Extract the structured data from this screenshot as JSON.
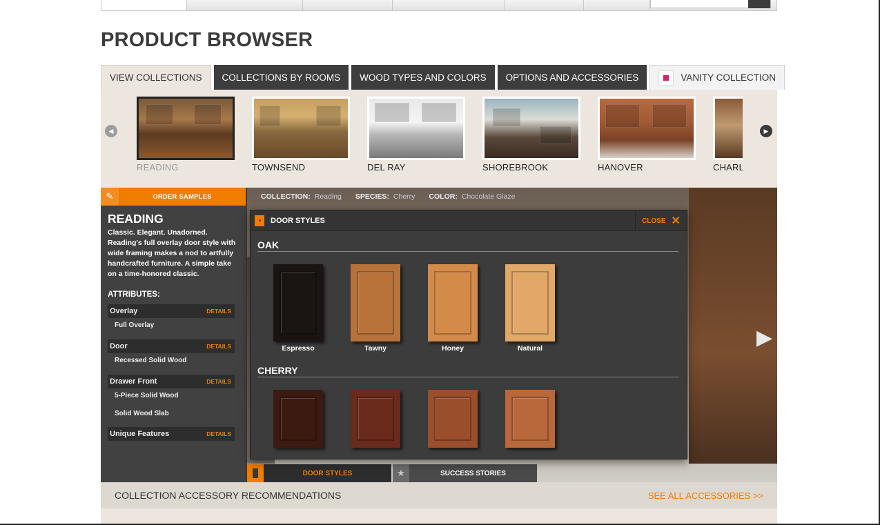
{
  "page_title": "PRODUCT BROWSER",
  "tabs": [
    {
      "label": "VIEW COLLECTIONS",
      "active": true
    },
    {
      "label": "COLLECTIONS BY ROOMS"
    },
    {
      "label": "WOOD TYPES AND COLORS"
    },
    {
      "label": "OPTIONS AND ACCESSORIES"
    },
    {
      "label": "VANITY COLLECTION"
    }
  ],
  "collections": [
    {
      "name": "READING",
      "active": true
    },
    {
      "name": "TOWNSEND"
    },
    {
      "name": "DEL RAY"
    },
    {
      "name": "SHOREBROOK"
    },
    {
      "name": "HANOVER"
    },
    {
      "name": "CHARL"
    }
  ],
  "sidebar": {
    "order_label": "ORDER SAMPLES",
    "collection_name": "READING",
    "description": "Classic. Elegant. Unadorned. Reading's full overlay door style with wide framing makes a nod to artfully handcrafted furniture. A simple take on a time-honored classic.",
    "attributes_heading": "ATTRIBUTES:",
    "details_label": "DETAILS",
    "attributes": [
      {
        "name": "Overlay",
        "values": [
          "Full Overlay"
        ]
      },
      {
        "name": "Door",
        "values": [
          "Recessed Solid Wood"
        ]
      },
      {
        "name": "Drawer Front",
        "values": [
          "5-Piece Solid Wood",
          "Solid Wood Slab"
        ]
      },
      {
        "name": "Unique Features",
        "values": []
      }
    ]
  },
  "info_bar": {
    "collection_key": "COLLECTION:",
    "collection_val": "Reading",
    "species_key": "SPECIES:",
    "species_val": "Cherry",
    "color_key": "COLOR:",
    "color_val": "Chocolate Glaze"
  },
  "modal": {
    "title": "DOOR STYLES",
    "close_label": "CLOSE",
    "species": [
      {
        "name": "OAK",
        "doors": [
          {
            "name": "Espresso",
            "color": "#1a1412"
          },
          {
            "name": "Tawny",
            "color": "#b8733a"
          },
          {
            "name": "Honey",
            "color": "#d48a48"
          },
          {
            "name": "Natural",
            "color": "#e2a868"
          }
        ]
      },
      {
        "name": "CHERRY",
        "doors": [
          {
            "name": "",
            "color": "#3c1a12"
          },
          {
            "name": "",
            "color": "#6a2a1c"
          },
          {
            "name": "",
            "color": "#9a4e2c"
          },
          {
            "name": "",
            "color": "#b8683a"
          }
        ]
      }
    ]
  },
  "bottom_tabs": {
    "door_styles": "DOOR STYLES",
    "success_stories": "SUCCESS STORIES"
  },
  "accessory_bar": {
    "title": "COLLECTION ACCESSORY RECOMMENDATIONS",
    "link": "SEE ALL ACCESSORIES >>"
  },
  "colors": {
    "accent": "#f07c00",
    "dark": "#3d3d3d",
    "beige": "#ece6df"
  }
}
